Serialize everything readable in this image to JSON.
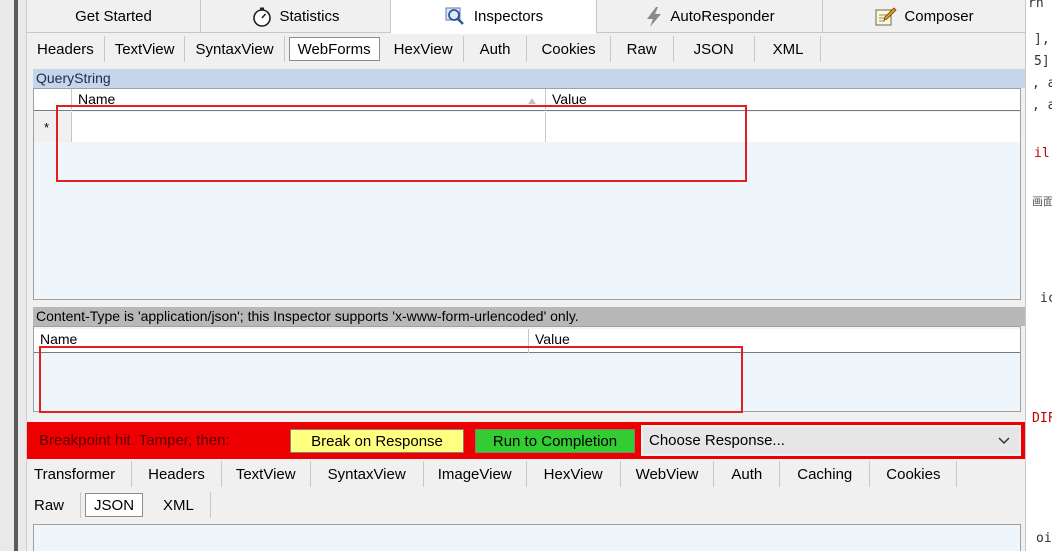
{
  "main_tabs": [
    {
      "label": "Get Started",
      "icon": "none"
    },
    {
      "label": "Statistics",
      "icon": "stopwatch-icon"
    },
    {
      "label": "Inspectors",
      "icon": "magnifier-icon"
    },
    {
      "label": "AutoResponder",
      "icon": "lightning-icon"
    },
    {
      "label": "Composer",
      "icon": "edit-pad-icon"
    }
  ],
  "request_tabs": [
    "Headers",
    "TextView",
    "SyntaxView",
    "WebForms",
    "HexView",
    "Auth",
    "Cookies",
    "Raw",
    "JSON",
    "XML"
  ],
  "request_active_tab": "WebForms",
  "querystring": {
    "header": "QueryString",
    "columns": [
      "Name",
      "Value"
    ],
    "new_row_marker": "*"
  },
  "body_section": {
    "header": "Content-Type is 'application/json'; this Inspector supports 'x-www-form-urlencoded' only.",
    "columns": [
      "Name",
      "Value"
    ]
  },
  "breakpoint": {
    "message": "Breakpoint hit. Tamper, then:",
    "break_on_response_label": "Break on Response",
    "run_to_completion_label": "Run to Completion",
    "choose_response_value": "Choose Response...",
    "colors": {
      "bar": "#ee0000",
      "break_btn": "#ffff80",
      "run_btn": "#33cc33"
    }
  },
  "response_tabs_row1": [
    "Transformer",
    "Headers",
    "TextView",
    "SyntaxView",
    "ImageView",
    "HexView",
    "WebView",
    "Auth",
    "Caching",
    "Cookies"
  ],
  "response_tabs_row2": [
    "Raw",
    "JSON",
    "XML"
  ],
  "response_active_tab": "JSON",
  "right_code_fragments": [
    "rn",
    "],",
    "5]",
    ", a",
    ", a",
    "il",
    "画面",
    "ic",
    "DIF",
    "oi"
  ]
}
